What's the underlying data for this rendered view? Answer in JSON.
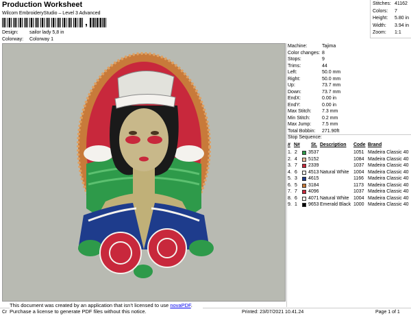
{
  "header": {
    "title": "Production Worksheet",
    "software": "Wilcom EmbroideryStudio – Level 3 Advanced",
    "barcode_mark": ","
  },
  "design": {
    "label": "Design:",
    "value": "sailor lady 5,8 in"
  },
  "colorway": {
    "label": "Colorway:",
    "value": "Colorway 1"
  },
  "stats": [
    {
      "label": "Stitches:",
      "value": "41162"
    },
    {
      "label": "Colors:",
      "value": "7"
    },
    {
      "label": "Height:",
      "value": "5.80 in"
    },
    {
      "label": "Width:",
      "value": "3.94 in"
    },
    {
      "label": "Zoom:",
      "value": "1:1"
    }
  ],
  "machine": [
    {
      "label": "Machine:",
      "value": "Tajima"
    },
    {
      "label": "Color changes:",
      "value": "8"
    },
    {
      "label": "Stops:",
      "value": "9"
    },
    {
      "label": "Trims:",
      "value": "44"
    },
    {
      "label": "Left:",
      "value": "50.0 mm"
    },
    {
      "label": "Right:",
      "value": "50.0 mm"
    },
    {
      "label": "Up:",
      "value": "73.7 mm"
    },
    {
      "label": "Down:",
      "value": "73.7 mm"
    },
    {
      "label": "EndX:",
      "value": "0.00 in"
    },
    {
      "label": "EndY:",
      "value": "0.00 in"
    },
    {
      "label": "Max Stitch:",
      "value": "7.3 mm"
    },
    {
      "label": "Min Stitch:",
      "value": "0.2 mm"
    },
    {
      "label": "Max Jump:",
      "value": "7.5 mm"
    },
    {
      "label": "Total Bobbin:",
      "value": "271.90ft"
    }
  ],
  "sequence": {
    "title": "Stop Sequence:",
    "headers": {
      "hash": "#",
      "num": "N#",
      "st": "St.",
      "desc": "Description",
      "code": "Code",
      "brand": "Brand"
    },
    "rows": [
      {
        "n": "1.",
        "num": "2",
        "color": "#2e9a4a",
        "st": "3537",
        "desc": "",
        "code": "1051",
        "brand": "Madeira Classic 40"
      },
      {
        "n": "2.",
        "num": "4",
        "color": "#e8b89a",
        "st": "5152",
        "desc": "",
        "code": "1084",
        "brand": "Madeira Classic 40"
      },
      {
        "n": "3.",
        "num": "7",
        "color": "#c8283c",
        "st": "2339",
        "desc": "",
        "code": "1037",
        "brand": "Madeira Classic 40"
      },
      {
        "n": "4.",
        "num": "6",
        "color": "#f4f2ee",
        "st": "4513",
        "desc": "Natural White",
        "code": "1004",
        "brand": "Madeira Classic 40"
      },
      {
        "n": "5.",
        "num": "3",
        "color": "#1e3c8c",
        "st": "4615",
        "desc": "",
        "code": "1166",
        "brand": "Madeira Classic 40"
      },
      {
        "n": "6.",
        "num": "5",
        "color": "#c87a3a",
        "st": "3184",
        "desc": "",
        "code": "1173",
        "brand": "Madeira Classic 40"
      },
      {
        "n": "7.",
        "num": "7",
        "color": "#c8283c",
        "st": "4096",
        "desc": "",
        "code": "1037",
        "brand": "Madeira Classic 40"
      },
      {
        "n": "8.",
        "num": "6",
        "color": "#f4f2ee",
        "st": "4071",
        "desc": "Natural White",
        "code": "1004",
        "brand": "Madeira Classic 40"
      },
      {
        "n": "9.",
        "num": "1",
        "color": "#000000",
        "st": "9653",
        "desc": "Emerald Black",
        "code": "1000",
        "brand": "Madeira Classic 40"
      }
    ]
  },
  "notice": {
    "line1": "This document was created by an application that isn’t licensed to use ",
    "link": "novaPDF",
    "line1_end": ".",
    "line2": "Purchase a license to generate PDF files without this notice."
  },
  "footer": {
    "left": "Cr",
    "printed": "Printed: 23/07/2021 10.41.24",
    "page": "Page 1 of 1"
  }
}
